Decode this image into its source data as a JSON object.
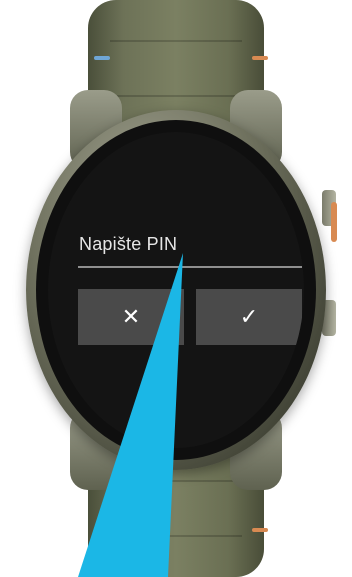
{
  "pin_prompt": {
    "label": "Napište PIN"
  },
  "buttons": {
    "cancel_icon": "close-icon",
    "cancel_glyph": "✕",
    "confirm_icon": "check-icon",
    "confirm_glyph": "✓"
  },
  "colors": {
    "screen_background": "#141414",
    "button_background": "#4a4a4a",
    "text": "#e6e6e6",
    "strap": "#6d7257",
    "pointer_highlight": "#1bb7e6"
  }
}
